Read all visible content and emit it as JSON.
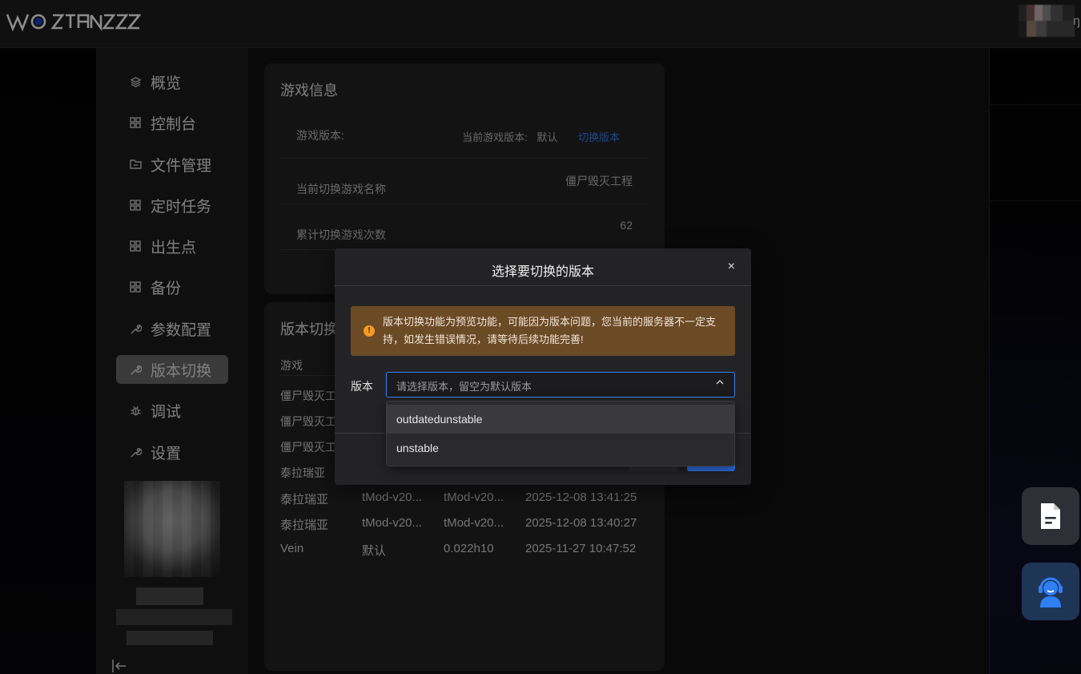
{
  "brand": {
    "logo_text": "WOSTIONSS"
  },
  "topbar": {
    "edge_char": "ŋ"
  },
  "sidebar": {
    "items": [
      {
        "label": "概览",
        "icon": "layers-icon"
      },
      {
        "label": "控制台",
        "icon": "grid-icon"
      },
      {
        "label": "文件管理",
        "icon": "folder-icon"
      },
      {
        "label": "定时任务",
        "icon": "grid-icon"
      },
      {
        "label": "出生点",
        "icon": "grid-icon"
      },
      {
        "label": "备份",
        "icon": "grid-icon"
      },
      {
        "label": "参数配置",
        "icon": "wrench-icon"
      },
      {
        "label": "版本切换",
        "icon": "wrench-icon",
        "active": true
      },
      {
        "label": "调试",
        "icon": "bug-icon"
      },
      {
        "label": "设置",
        "icon": "wrench-icon"
      }
    ]
  },
  "game_info": {
    "title": "游戏信息",
    "version_label": "游戏版本:",
    "current_version_label": "当前游戏版本:",
    "current_version_value": "默认",
    "switch_link": "切换版本",
    "switched_name_label": "当前切换游戏名称",
    "switched_name_value": "僵尸毁灭工程",
    "switch_count_label": "累计切换游戏次数",
    "switch_count_value": "62"
  },
  "version_switch": {
    "title": "版本切换",
    "col_game": "游戏",
    "rows": [
      {
        "game": "僵尸毁灭工",
        "c2": "",
        "c3": "",
        "time": ""
      },
      {
        "game": "僵尸毁灭工",
        "c2": "",
        "c3": "",
        "time": ""
      },
      {
        "game": "僵尸毁灭工",
        "c2": "",
        "c3": "",
        "time": ""
      },
      {
        "game": "泰拉瑞亚",
        "c2": "",
        "c3": "",
        "time": ""
      },
      {
        "game": "泰拉瑞亚",
        "c2": "tMod-v20...",
        "c3": "tMod-v20...",
        "time": "2025-12-08 13:41:25"
      },
      {
        "game": "泰拉瑞亚",
        "c2": "tMod-v20...",
        "c3": "tMod-v20...",
        "time": "2025-12-08 13:40:27"
      },
      {
        "game": "Vein",
        "c2": "默认",
        "c3": "0.022h10",
        "time": "2025-11-27 10:47:52"
      }
    ]
  },
  "dialog": {
    "title": "选择要切换的版本",
    "close": "×",
    "alert_text": "版本切换功能为预览功能，可能因为版本问题，您当前的服务器不一定支持，如发生错误情况，请等待后续功能完善!",
    "field_label": "版本",
    "select_placeholder": "请选择版本，留空为默认版本",
    "options": [
      "outdatedunstable",
      "unstable"
    ]
  },
  "colors": {
    "accent": "#3b82f6",
    "warning_bg": "#6b4a26",
    "warning_icon": "#f59a23"
  },
  "fabs": [
    {
      "icon": "document-icon"
    },
    {
      "icon": "customer-service-icon"
    }
  ]
}
